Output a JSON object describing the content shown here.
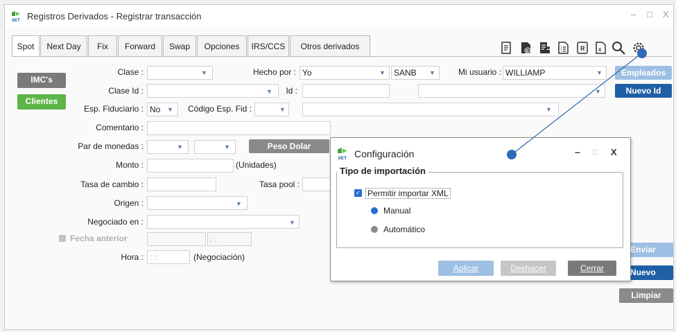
{
  "window": {
    "title": "Registros Derivados - Registrar transacción",
    "minimize": "–",
    "maximize": "□",
    "close": "X"
  },
  "tabs": [
    "Spot",
    "Next Day",
    "Fix",
    "Forward",
    "Swap",
    "Opciones",
    "IRS/CCS",
    "Otros derivados"
  ],
  "toolbar_icons": [
    "document-edit-icon",
    "document-b-icon",
    "document-person-icon",
    "document-list-icon",
    "document-r-icon",
    "document-x-icon",
    "search-icon",
    "gear-icon"
  ],
  "form": {
    "imcs_button": "IMC's",
    "clientes_button": "Clientes",
    "clase_label": "Clase :",
    "clase_value": "",
    "hecho_por_label": "Hecho por :",
    "hecho_por_value": "Yo",
    "sanb_value": "SANB",
    "mi_usuario_label": "Mi usuario :",
    "mi_usuario_value": "WILLIAMP",
    "empleados_button": "Empleados",
    "clase_id_label": "Clase Id :",
    "id_label": "Id :",
    "nuevo_id_button": "Nuevo Id",
    "esp_fiduciario_label": "Esp. Fiduciario :",
    "esp_fiduciario_value": "No",
    "codigo_esp_fid_label": "Código Esp. Fid :",
    "comentario_label": "Comentario :",
    "par_monedas_label": "Par de monedas :",
    "peso_dolar_button": "Peso Dolar",
    "monto_label": "Monto :",
    "unidades_label": "(Unidades)",
    "tasa_cambio_label": "Tasa de cambio :",
    "tasa_pool_label": "Tasa pool :",
    "origen_label": "Origen :",
    "negociado_label": "Negociado en :",
    "fecha_anterior_label": "Fecha anterior",
    "fecha_time_placeholder": ": :",
    "hora_label": "Hora :",
    "hora_value": ": :",
    "negociacion_label": "(Negociación)",
    "enviar_button": "Enviar",
    "nuevo_button": "Nuevo",
    "limpiar_button": "Limpiar"
  },
  "dialog": {
    "title": "Configuración",
    "min": "–",
    "max": "□",
    "close": "X",
    "group_title": "Tipo de importación",
    "checkbox_label": "Permitir importar XML",
    "checkbox_checked": true,
    "radio_manual": "Manual",
    "radio_automatico": "Automático",
    "aplicar_button": "Aplicar",
    "deshacer_button": "Deshacer",
    "cerrar_button": "Cerrar"
  },
  "colors": {
    "accent_blue": "#1f5fa6",
    "disabled_blue": "#9dbfe3",
    "green": "#5db548",
    "gray_button": "#8a8a8a",
    "dropdown_arrow": "#5c7fa8"
  }
}
